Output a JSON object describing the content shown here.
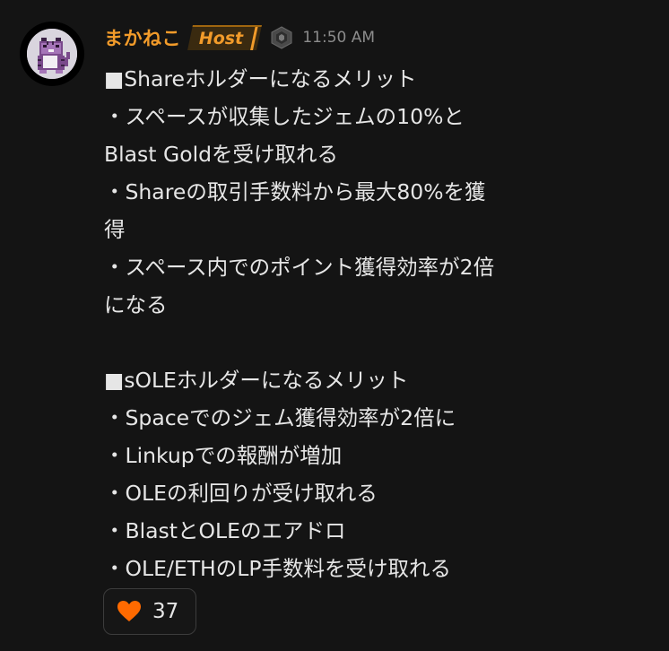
{
  "message": {
    "author": {
      "name": "まかねこ",
      "role_badge": "Host",
      "avatar_icon": "pixel-cat-icon",
      "rank_icon": "hexagon-rank-icon"
    },
    "timestamp": "11:50 AM",
    "lines": [
      "■Shareホルダーになるメリット",
      "・スペースが収集したジェムの10%と",
      "Blast Goldを受け取れる",
      "・Shareの取引手数料から最大80%を獲",
      "得",
      "・スペース内でのポイント獲得効率が2倍",
      "になる",
      "",
      "■sOLEホルダーになるメリット",
      "・Spaceでのジェム獲得効率が2倍に",
      "・Linkupでの報酬が増加",
      "・OLEの利回りが受け取れる",
      "・BlastとOLEのエアドロ",
      "・OLE/ETHのLP手数料を受け取れる"
    ],
    "reaction": {
      "icon": "heart-icon",
      "count": "37"
    }
  },
  "colors": {
    "background": "#141414",
    "username": "#f29b2a",
    "text": "#e6e6e6",
    "timestamp": "#8c8c8c",
    "heart": "#ff6a00"
  }
}
